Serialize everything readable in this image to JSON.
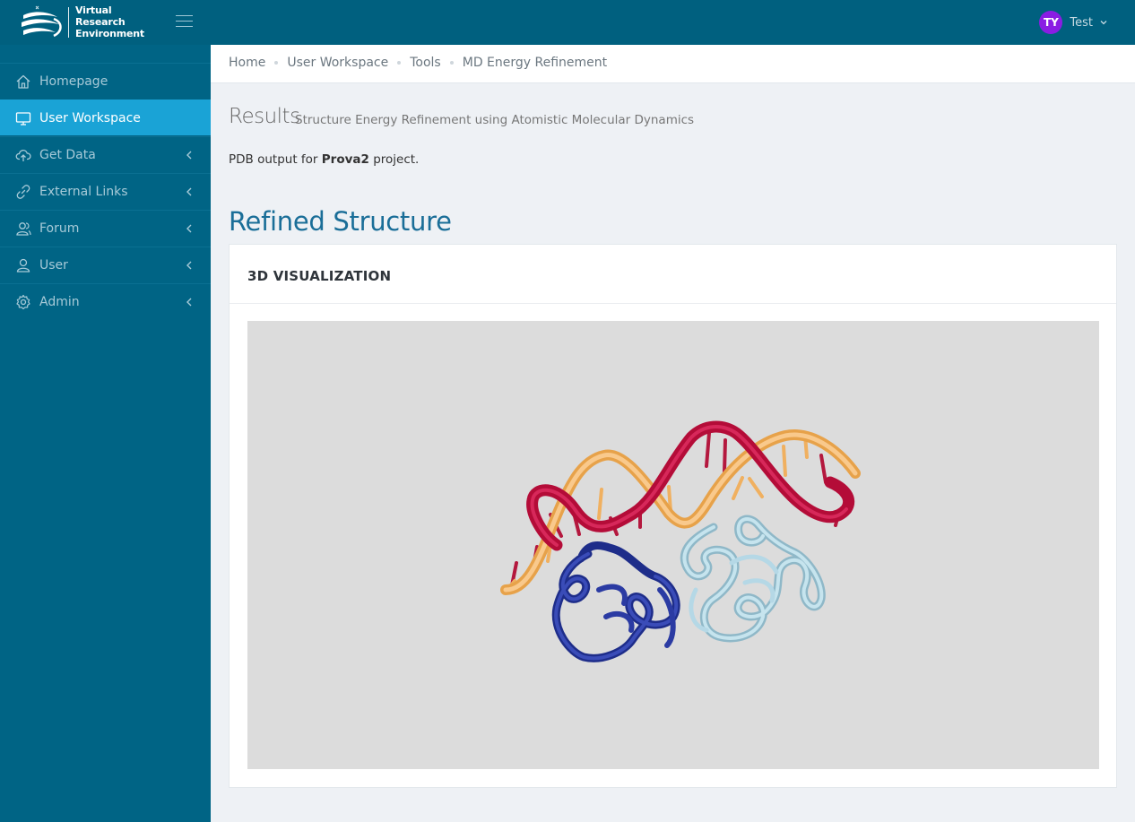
{
  "header": {
    "logo_lines": [
      "Virtual",
      "Research",
      "Environment"
    ],
    "user": {
      "initials": "TY",
      "name": "Test"
    },
    "colors": {
      "bar": "#00607f",
      "avatar": "#8a1de3"
    }
  },
  "sidebar": {
    "items": [
      {
        "label": "Homepage",
        "icon": "home-icon",
        "expandable": false,
        "active": false
      },
      {
        "label": "User Workspace",
        "icon": "monitor-icon",
        "expandable": false,
        "active": true
      },
      {
        "label": "Get Data",
        "icon": "cloud-upload-icon",
        "expandable": true,
        "active": false
      },
      {
        "label": "External Links",
        "icon": "link-icon",
        "expandable": true,
        "active": false
      },
      {
        "label": "Forum",
        "icon": "users-icon",
        "expandable": true,
        "active": false
      },
      {
        "label": "User",
        "icon": "user-icon",
        "expandable": true,
        "active": false
      },
      {
        "label": "Admin",
        "icon": "gear-icon",
        "expandable": true,
        "active": false
      }
    ],
    "colors": {
      "bg": "#006485",
      "active": "#1aa3d6"
    }
  },
  "breadcrumb": [
    "Home",
    "User Workspace",
    "Tools",
    "MD Energy Refinement"
  ],
  "page": {
    "title": "Results",
    "subtitle": "Structure Energy Refinement using Atomistic Molecular Dynamics",
    "desc_prefix": "PDB output for ",
    "project": "Prova2",
    "desc_suffix": " project.",
    "section_title": "Refined Structure"
  },
  "panel": {
    "title": "3D VISUALIZATION",
    "viewer_bg": "#dcdcdc"
  }
}
